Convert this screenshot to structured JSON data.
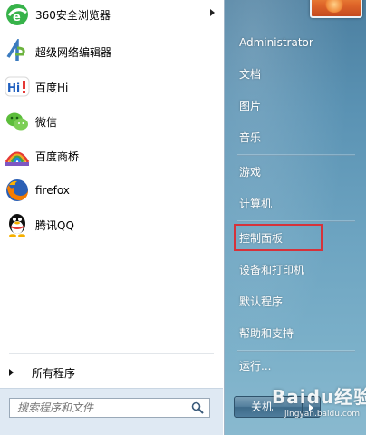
{
  "programs": [
    {
      "label": "360安全浏览器",
      "icon": "360-browser-icon",
      "has_submenu": true
    },
    {
      "label": "超级网络编辑器",
      "icon": "super-network-editor-icon",
      "has_submenu": false
    },
    {
      "label": "百度Hi",
      "icon": "baidu-hi-icon",
      "has_submenu": false
    },
    {
      "label": "微信",
      "icon": "wechat-icon",
      "has_submenu": false
    },
    {
      "label": "百度商桥",
      "icon": "baidu-shangqiao-icon",
      "has_submenu": false
    },
    {
      "label": "firefox",
      "icon": "firefox-icon",
      "has_submenu": false
    },
    {
      "label": "腾讯QQ",
      "icon": "qq-penguin-icon",
      "has_submenu": false
    }
  ],
  "all_programs": {
    "label": "所有程序"
  },
  "search": {
    "placeholder": "搜索程序和文件",
    "icon": "search-magnifier-icon"
  },
  "user": {
    "name": "Administrator",
    "picture": "user-picture-flower"
  },
  "right_items": {
    "documents": "文档",
    "pictures": "图片",
    "music": "音乐",
    "games": "游戏",
    "computer": "计算机",
    "control_panel": "控制面板",
    "devices_printers": "设备和打印机",
    "default_programs": "默认程序",
    "help_support": "帮助和支持",
    "run": "运行..."
  },
  "shutdown": {
    "label": "关机"
  },
  "watermark": {
    "main": "Baidu经验",
    "sub": "jingyan.baidu.com"
  },
  "colors": {
    "highlight_border": "#d6323a",
    "right_pane_top": "#4c7fa0",
    "right_pane_bottom": "#89b9cf",
    "left_pane": "#ffffff",
    "search_area": "#dfe9f3"
  }
}
